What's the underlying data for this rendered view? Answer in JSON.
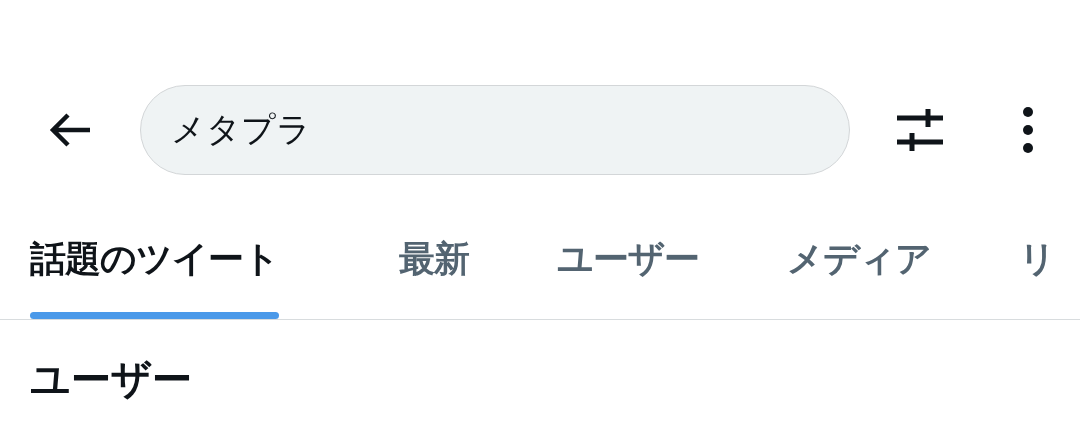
{
  "search": {
    "value": "メタプラ"
  },
  "tabs": [
    {
      "label": "話題のツイート",
      "selected": true
    },
    {
      "label": "最新",
      "selected": false
    },
    {
      "label": "ユーザー",
      "selected": false
    },
    {
      "label": "メディア",
      "selected": false
    },
    {
      "label": "リ",
      "selected": false
    }
  ],
  "section": {
    "title": "ユーザー"
  }
}
